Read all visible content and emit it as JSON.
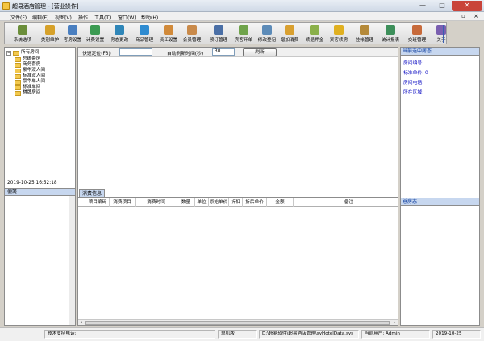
{
  "window": {
    "title": "超易酒店管理 - [营业操作]"
  },
  "menu": [
    "文件(F)",
    "编辑(E)",
    "视图(V)",
    "操作",
    "工具(T)",
    "窗口(W)",
    "帮助(H)"
  ],
  "mdi_controls": "_ ▫ ×",
  "toolbar": [
    {
      "label": "系统选项",
      "icon": "settings-icon",
      "color": "#6b8e3a"
    },
    {
      "label": "类别维护",
      "icon": "category-icon",
      "color": "#d6a12a"
    },
    {
      "label": "客房设置",
      "icon": "room-icon",
      "color": "#4a7fc0"
    },
    {
      "label": "计费设置",
      "icon": "billing-icon",
      "color": "#3b9b52"
    },
    {
      "label": "房态更改",
      "icon": "status-icon",
      "color": "#2f86b8"
    },
    {
      "label": "商品管理",
      "icon": "goods-icon",
      "color": "#2e8bd1"
    },
    {
      "label": "员工设置",
      "icon": "staff-icon",
      "color": "#d18a3a"
    },
    {
      "label": "会员管理",
      "icon": "member-icon",
      "color": "#c98a4a"
    },
    {
      "label": "预订管理",
      "icon": "booking-icon",
      "color": "#4a6fa6"
    },
    {
      "label": "宾客开单",
      "icon": "checkin-icon",
      "color": "#6fa34b"
    },
    {
      "label": "修改登记",
      "icon": "edit-icon",
      "color": "#5c8bb8"
    },
    {
      "label": "增加消费",
      "icon": "add-consume-icon",
      "color": "#d9a030"
    },
    {
      "label": "续退押金",
      "icon": "deposit-icon",
      "color": "#8ab04a"
    },
    {
      "label": "宾客续房",
      "icon": "extend-icon",
      "color": "#e0b020"
    },
    {
      "label": "挂帐管理",
      "icon": "credit-icon",
      "color": "#b58a3a"
    },
    {
      "label": "统计报表",
      "icon": "report-icon",
      "color": "#3d8f5a"
    },
    {
      "label": "交班管理",
      "icon": "shift-icon",
      "color": "#c76a3a"
    },
    {
      "label": "关于",
      "icon": "help-icon",
      "color": "#7a5fb0"
    }
  ],
  "tree": {
    "root": "所有房间",
    "children": [
      "总统套房",
      "商务套房",
      "豪华双人间",
      "标准双人间",
      "豪华单人间",
      "标准单间",
      "棋牌房间"
    ]
  },
  "datetime": "2019-10-25 16:52:18",
  "notes_label": "便笺",
  "quick_search": {
    "locate_label": "快速定位(F3)",
    "locate_value": "",
    "refresh_label": "自动刷新时间(秒)",
    "refresh_value": "30",
    "refresh_button": "刷新"
  },
  "consumption_tab": "消费信息",
  "table_columns": [
    "项目编码",
    "消费项目",
    "消费时间",
    "数量",
    "单位",
    "原始单价",
    "折扣",
    "折后单价",
    "金额",
    "备注"
  ],
  "table_rows": [],
  "right_panel": {
    "header": "当前选中房态",
    "room_no_label": "房间编号:",
    "std_price_label": "标准单价: 0",
    "phone_label": "房间电话:",
    "area_label": "所在区域:",
    "footer": "总房态"
  },
  "status_bar": {
    "support": "技术支持电话:",
    "mode": "单机版",
    "path": "D:\\超易软件\\超易酒店管理\\syHotelData.sys",
    "user": "当前用户: Admin",
    "date": "2019-10-25"
  }
}
